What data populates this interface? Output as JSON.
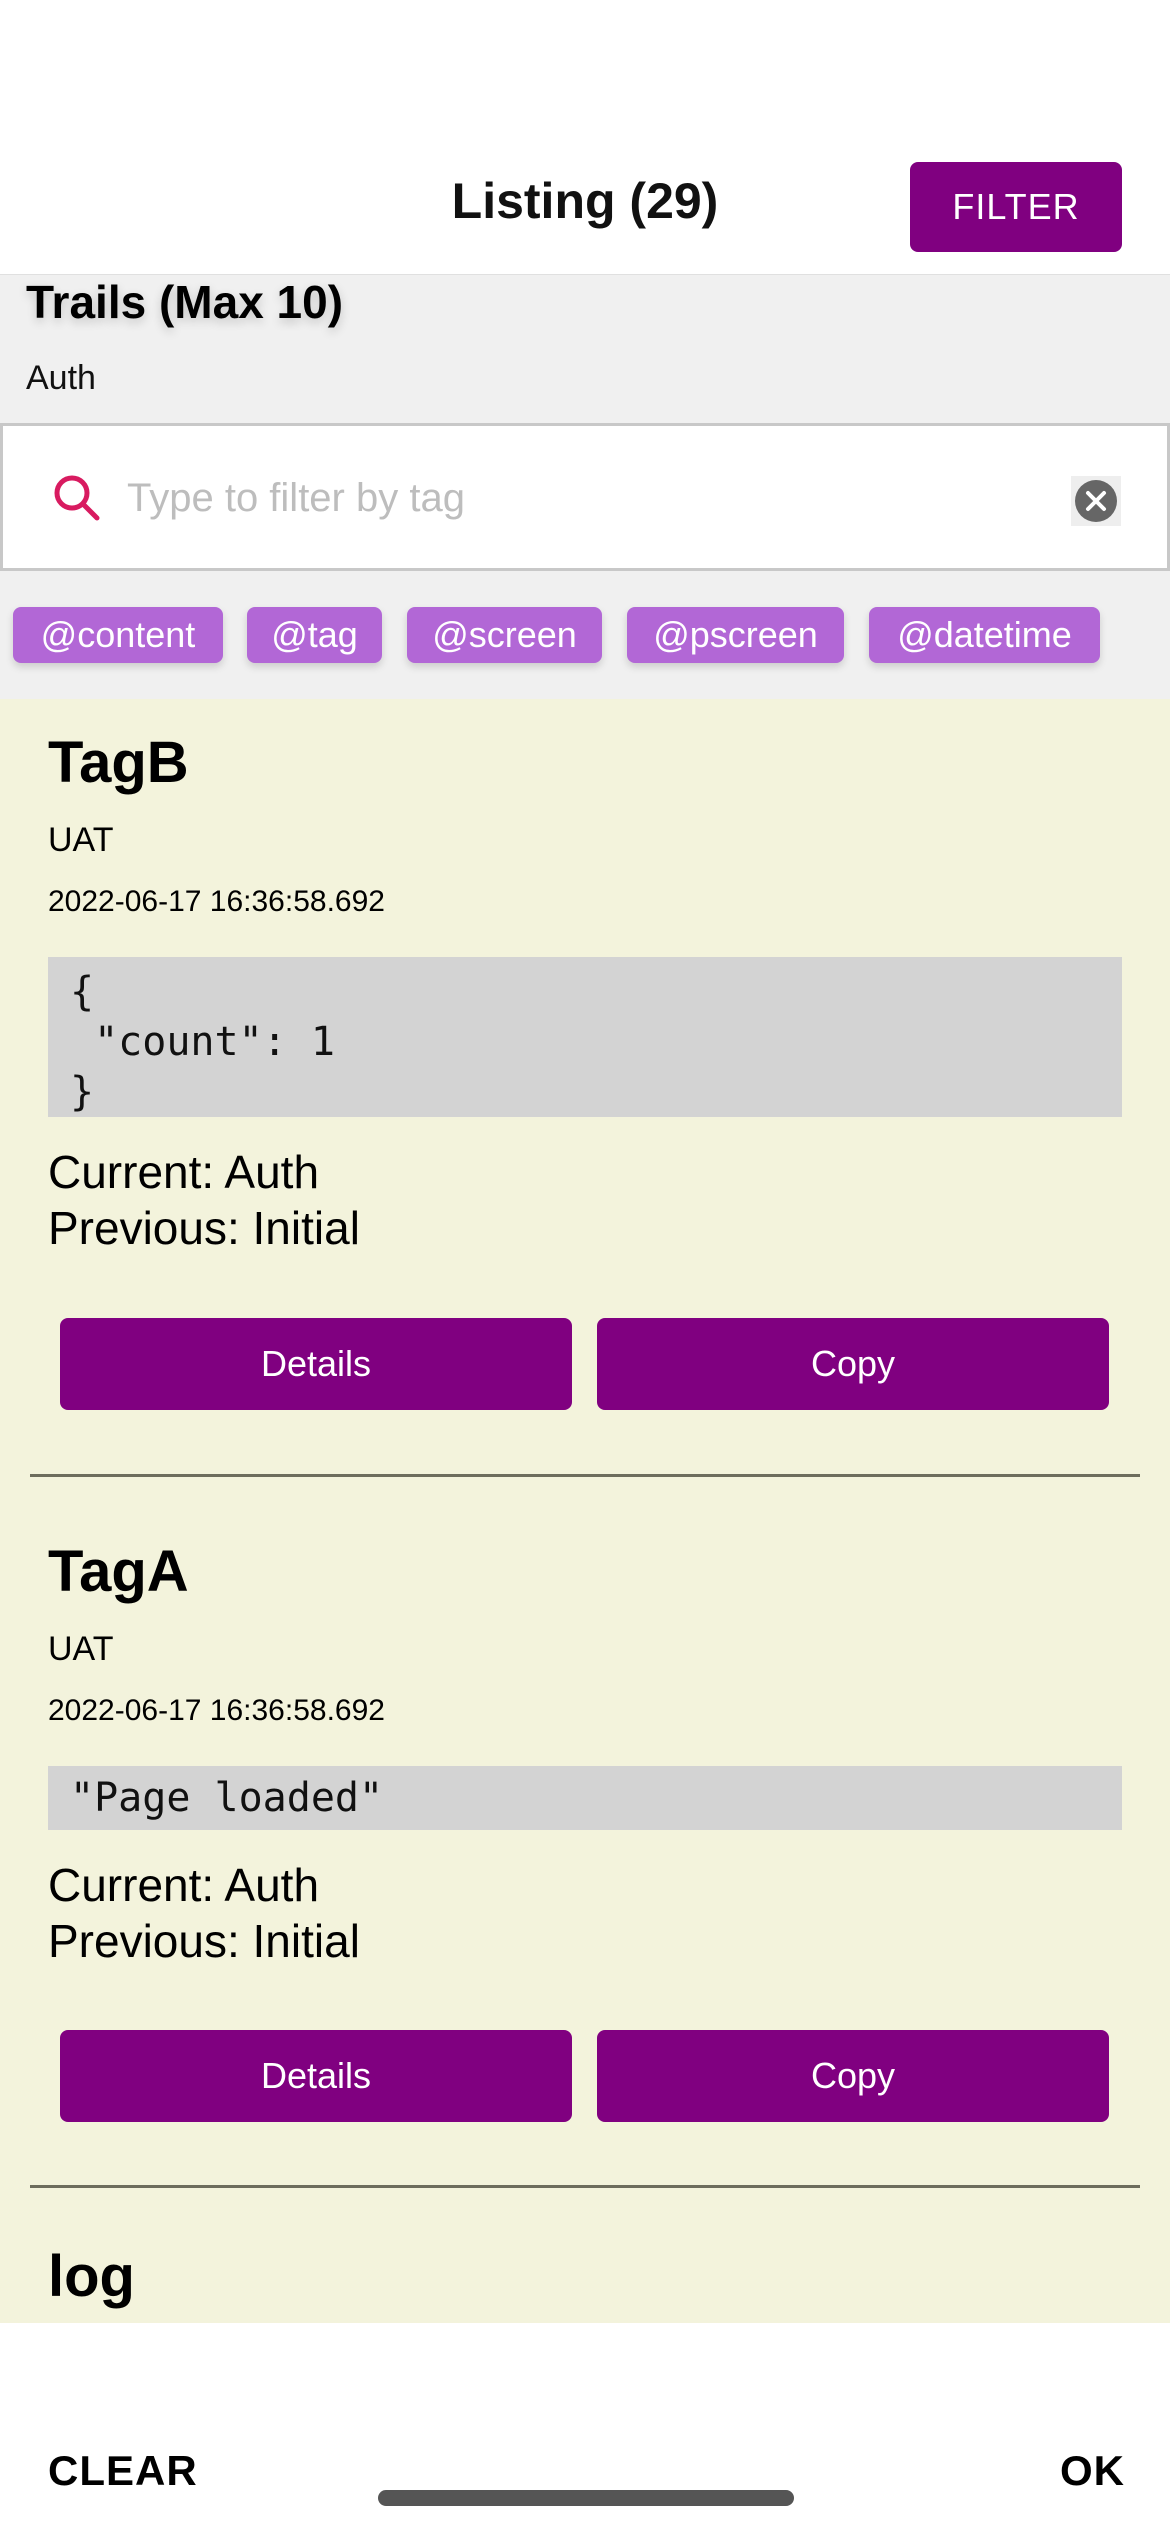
{
  "header": {
    "title": "Listing (29)",
    "filter_label": "FILTER"
  },
  "trails": {
    "title": "Trails (Max 10)",
    "value": "Auth"
  },
  "search": {
    "placeholder": "Type to filter by tag",
    "value": ""
  },
  "chips": [
    "@content",
    "@tag",
    "@screen",
    "@pscreen",
    "@datetime"
  ],
  "entries": [
    {
      "tag": "TagB",
      "env": "UAT",
      "datetime": "2022-06-17 16:36:58.692",
      "content": "{\n \"count\": 1\n}",
      "current": "Current: Auth",
      "previous": "Previous: Initial",
      "details_label": "Details",
      "copy_label": "Copy"
    },
    {
      "tag": "TagA",
      "env": "UAT",
      "datetime": "2022-06-17 16:36:58.692",
      "content": "\"Page loaded\"",
      "current": "Current: Auth",
      "previous": "Previous: Initial",
      "details_label": "Details",
      "copy_label": "Copy"
    },
    {
      "tag": "log"
    }
  ],
  "footer": {
    "clear_label": "CLEAR",
    "ok_label": "OK"
  },
  "colors": {
    "accent": "#800080",
    "chip": "#b267d6",
    "list_background": "#f3f3dc",
    "search_icon": "#d81b60"
  }
}
